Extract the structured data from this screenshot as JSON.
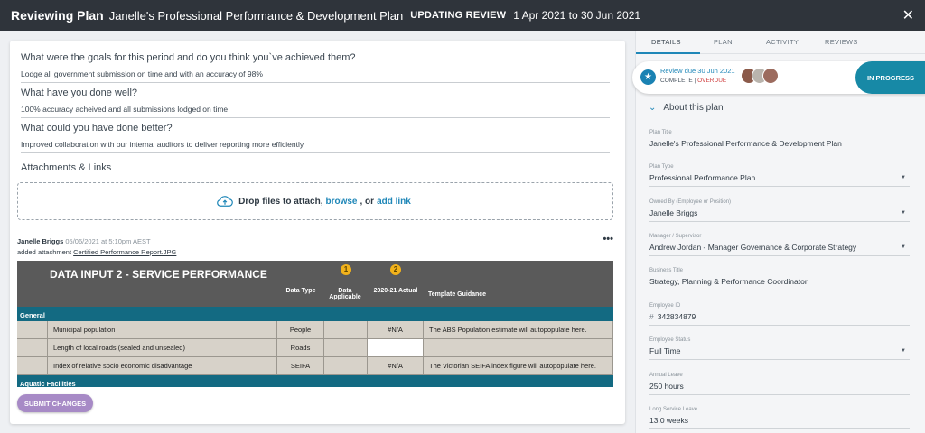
{
  "header": {
    "title_bold": "Reviewing Plan",
    "plan_name": "Janelle's Professional Performance & Development Plan",
    "status": "UPDATING REVIEW",
    "dates": "1 Apr 2021 to 30 Jun 2021"
  },
  "main": {
    "questions": [
      {
        "q": "What were the goals for this period and do you think you`ve achieved them?",
        "a": "Lodge all government submission on time and with an accuracy of 98%"
      },
      {
        "q": "What have you done well?",
        "a": "100% accuracy acheived and all submissions lodged on time"
      },
      {
        "q": "What could you have done better?",
        "a": "Improved collaboration with our internal auditors to deliver reporting more efficiently"
      }
    ],
    "attachments_title": "Attachments & Links",
    "dropzone": {
      "prefix": "Drop files to attach,",
      "browse": "browse",
      "or": ", or",
      "add_link": "add link"
    },
    "activity": {
      "author": "Janelle Briggs",
      "time": "05/06/2021 at 5:10pm AEST",
      "action": "added attachment",
      "file": "Certified Performance Report.JPG"
    },
    "sheet": {
      "title": "DATA INPUT 2 - SERVICE PERFORMANCE",
      "badge1": "1",
      "badge2": "2",
      "col_data_type": "Data Type",
      "col_data_applicable": "Data Applicable",
      "col_actual": "2020-21 Actual",
      "col_guidance": "Template Guidance",
      "section1": "General",
      "rows": [
        {
          "label": "Municipal population",
          "type": "People",
          "actual": "#N/A",
          "guidance": "The ABS Population estimate will autopopulate here."
        },
        {
          "label": "Length of local roads (sealed and unsealed)",
          "type": "Roads",
          "actual": "",
          "guidance": ""
        },
        {
          "label": "Index of relative socio economic disadvantage",
          "type": "SEIFA",
          "actual": "#N/A",
          "guidance": "The Victorian SEIFA index figure will autopopulate here."
        }
      ],
      "section2": "Aquatic Facilities"
    },
    "submit_label": "SUBMIT CHANGES"
  },
  "panel": {
    "tabs": [
      "DETAILS",
      "PLAN",
      "ACTIVITY",
      "REVIEWS"
    ],
    "review_due": "Review due 30 Jun 2021",
    "complete": "COMPLETE",
    "sep": " | ",
    "overdue": "OVERDUE",
    "in_progress": "IN PROGRESS",
    "about_title": "About this plan",
    "fields": [
      {
        "label": "Plan Title",
        "value": "Janelle's Professional Performance & Development Plan"
      },
      {
        "label": "Plan Type",
        "value": "Professional Performance Plan"
      },
      {
        "label": "Owned By (Employee or Position)",
        "value": "Janelle Briggs"
      },
      {
        "label": "Manager / Supervisor",
        "value": "Andrew Jordan - Manager Governance & Corporate Strategy"
      },
      {
        "label": "Business Title",
        "value": "Strategy, Planning & Performance Coordinator"
      },
      {
        "label": "Employee ID",
        "value": "342834879"
      },
      {
        "label": "Employee Status",
        "value": "Full Time"
      },
      {
        "label": "Annual Leave",
        "value": "250 hours"
      },
      {
        "label": "Long Service Leave",
        "value": "13.0 weeks"
      }
    ]
  },
  "colors": {
    "header_bg": "#2f343b",
    "accent": "#1f87b8",
    "in_progress": "#1789a6",
    "submit": "#a78ac6",
    "overdue": "#d04040"
  }
}
